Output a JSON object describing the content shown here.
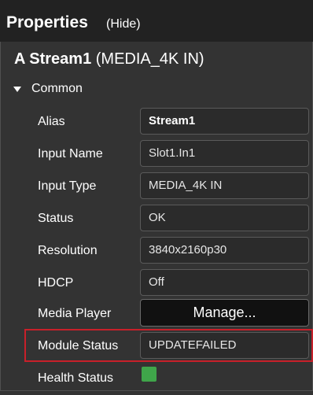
{
  "panel": {
    "title": "Properties",
    "hide_label": "(Hide)"
  },
  "stream": {
    "prefix": "A Stream1",
    "type": "(MEDIA_4K IN)"
  },
  "section": {
    "label": "Common",
    "expanded": true
  },
  "properties": {
    "alias": {
      "label": "Alias",
      "value": "Stream1"
    },
    "input_name": {
      "label": "Input Name",
      "value": "Slot1.In1"
    },
    "input_type": {
      "label": "Input Type",
      "value": "MEDIA_4K IN"
    },
    "status": {
      "label": "Status",
      "value": "OK"
    },
    "resolution": {
      "label": "Resolution",
      "value": "3840x2160p30"
    },
    "hdcp": {
      "label": "HDCP",
      "value": "Off"
    },
    "media_player": {
      "label": "Media Player",
      "button": "Manage..."
    },
    "module_status": {
      "label": "Module Status",
      "value": "UPDATEFAILED"
    },
    "health_status": {
      "label": "Health Status",
      "indicator_color": "#3fa54a"
    }
  },
  "colors": {
    "highlight": "#c8202a",
    "panel_bg": "#333333",
    "header_bg": "#222222"
  }
}
